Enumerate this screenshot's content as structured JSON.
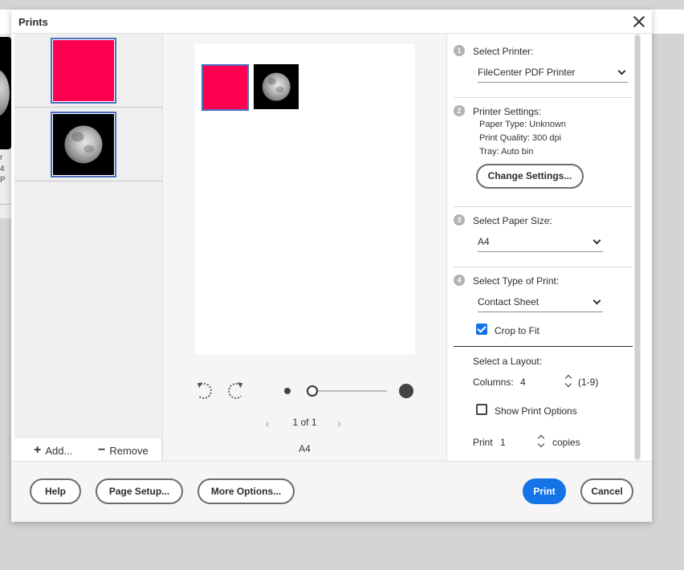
{
  "dialog": {
    "title": "Prints"
  },
  "background": {
    "text_line1": "r",
    "text_line2": "4 P"
  },
  "thumbnails": [
    {
      "kind": "red",
      "color": "#ff0050"
    },
    {
      "kind": "moon",
      "color": "#000000"
    }
  ],
  "thumb_actions": {
    "add": "Add...",
    "remove": "Remove",
    "add_icon": "plus-icon",
    "remove_icon": "minus-icon"
  },
  "preview": {
    "pager_text": "1 of 1",
    "prev": "‹",
    "next": "›",
    "paper": "A4"
  },
  "steps": {
    "one": {
      "num": "1",
      "label": "Select Printer:",
      "printer": "FileCenter PDF Printer"
    },
    "two": {
      "num": "2",
      "label": "Printer Settings:",
      "paper_type": "Paper Type: Unknown",
      "print_quality": "Print Quality: 300 dpi",
      "tray": "Tray: Auto bin",
      "change_button": "Change Settings..."
    },
    "three": {
      "num": "3",
      "label": "Select Paper Size:",
      "size": "A4"
    },
    "four": {
      "num": "4",
      "label": "Select Type of Print:",
      "type": "Contact Sheet",
      "crop_label": "Crop to Fit",
      "crop_checked": true
    }
  },
  "layout": {
    "title": "Select a Layout:",
    "columns_label": "Columns:",
    "columns_value": "4",
    "columns_range": "(1-9)",
    "show_options": "Show Print Options",
    "show_options_checked": false,
    "print_label": "Print",
    "copies_value": "1",
    "copies_label": "copies"
  },
  "footer": {
    "help": "Help",
    "page_setup": "Page Setup...",
    "more_options": "More Options...",
    "print": "Print",
    "cancel": "Cancel"
  },
  "accent": "#1473e6"
}
